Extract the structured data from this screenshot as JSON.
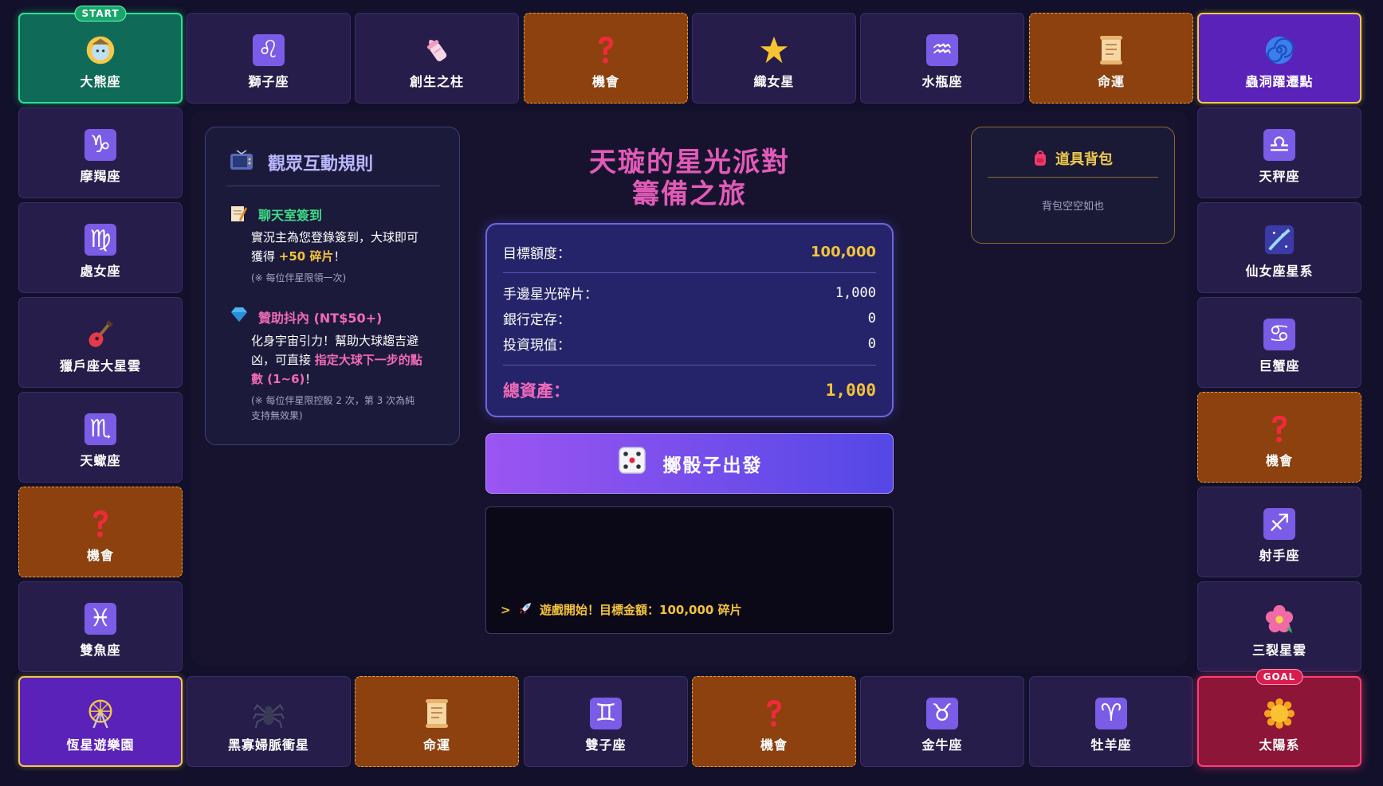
{
  "board": {
    "top_row": [
      {
        "label": "大熊座",
        "icon": "bear-moon-icon",
        "kind": "start"
      },
      {
        "label": "獅子座",
        "icon": "♌",
        "kind": "zodiac"
      },
      {
        "label": "創生之柱",
        "icon": "baby-bottle-icon",
        "kind": "normal"
      },
      {
        "label": "機會",
        "icon": "question-icon",
        "kind": "chance"
      },
      {
        "label": "織女星",
        "icon": "star-icon",
        "kind": "normal"
      },
      {
        "label": "水瓶座",
        "icon": "♒",
        "kind": "zodiac"
      },
      {
        "label": "命運",
        "icon": "scroll-icon",
        "kind": "chance"
      },
      {
        "label": "蟲洞躍遷點",
        "icon": "spiral-icon",
        "kind": "warp"
      }
    ],
    "left_col": [
      {
        "label": "摩羯座",
        "icon": "♑",
        "kind": "zodiac"
      },
      {
        "label": "處女座",
        "icon": "♍",
        "kind": "zodiac"
      },
      {
        "label": "獵戶座大星雲",
        "icon": "guitar-icon",
        "kind": "normal"
      },
      {
        "label": "天蠍座",
        "icon": "♏",
        "kind": "zodiac"
      },
      {
        "label": "機會",
        "icon": "question-icon",
        "kind": "chance"
      },
      {
        "label": "雙魚座",
        "icon": "♓",
        "kind": "zodiac"
      }
    ],
    "right_col": [
      {
        "label": "天秤座",
        "icon": "♎",
        "kind": "zodiac"
      },
      {
        "label": "仙女座星系",
        "icon": "galaxy-icon",
        "kind": "normal"
      },
      {
        "label": "巨蟹座",
        "icon": "♋",
        "kind": "zodiac"
      },
      {
        "label": "機會",
        "icon": "question-icon",
        "kind": "chance"
      },
      {
        "label": "射手座",
        "icon": "♐",
        "kind": "zodiac"
      },
      {
        "label": "三裂星雲",
        "icon": "flower-icon",
        "kind": "normal"
      }
    ],
    "bottom_row": [
      {
        "label": "恆星遊樂園",
        "icon": "ferris-wheel-icon",
        "kind": "warp"
      },
      {
        "label": "黑寡婦脈衝星",
        "icon": "spider-icon",
        "kind": "normal"
      },
      {
        "label": "命運",
        "icon": "scroll-icon",
        "kind": "chance"
      },
      {
        "label": "雙子座",
        "icon": "♊",
        "kind": "zodiac"
      },
      {
        "label": "機會",
        "icon": "question-icon",
        "kind": "chance"
      },
      {
        "label": "金牛座",
        "icon": "♉",
        "kind": "zodiac"
      },
      {
        "label": "牡羊座",
        "icon": "♈",
        "kind": "zodiac"
      },
      {
        "label": "太陽系",
        "icon": "sun-icon",
        "kind": "goal"
      }
    ],
    "start_badge": "START",
    "goal_badge": "GOAL"
  },
  "rules": {
    "title": "觀眾互動規則",
    "chat": {
      "title": "聊天室簽到",
      "text_a": "實況主為您登錄簽到，大球即可",
      "text_b_pre": "獲得 ",
      "text_b_hl": "+50 碎片",
      "text_b_post": "！",
      "note": "(※ 每位伴星限領一次)"
    },
    "donate": {
      "title": "贊助抖內 (NT$50+)",
      "text_a": "化身宇宙引力！幫助大球趨吉避",
      "text_b_pre": "凶，可直接 ",
      "text_b_hl": "指定大球下一步的點",
      "text_c_hl": "數 (1~6)",
      "text_c_post": "！",
      "note_a": "(※ 每位伴星限控骰 2 次，第 3 次為純",
      "note_b": "支持無效果)"
    }
  },
  "title": {
    "line1": "天璇的星光派對",
    "line2": "籌備之旅"
  },
  "finance": {
    "target_label": "目標額度：",
    "target_value": "100,000",
    "cash_label": "手邊星光碎片：",
    "cash_value": "1,000",
    "bank_label": "銀行定存：",
    "bank_value": "0",
    "invest_label": "投資現值：",
    "invest_value": "0",
    "total_label": "總資產：",
    "total_value": "1,000"
  },
  "roll_button": {
    "label": "擲骰子出發"
  },
  "log": {
    "prefix": ">",
    "message": "遊戲開始！目標金額：100,000 碎片"
  },
  "bag": {
    "title": "道具背包",
    "empty": "背包空空如也"
  },
  "colors": {
    "accent": "#7b5ce6",
    "chance": "#8c410f",
    "gold": "#f3c33b",
    "pink": "#e25ab7",
    "green": "#2ee08f"
  }
}
